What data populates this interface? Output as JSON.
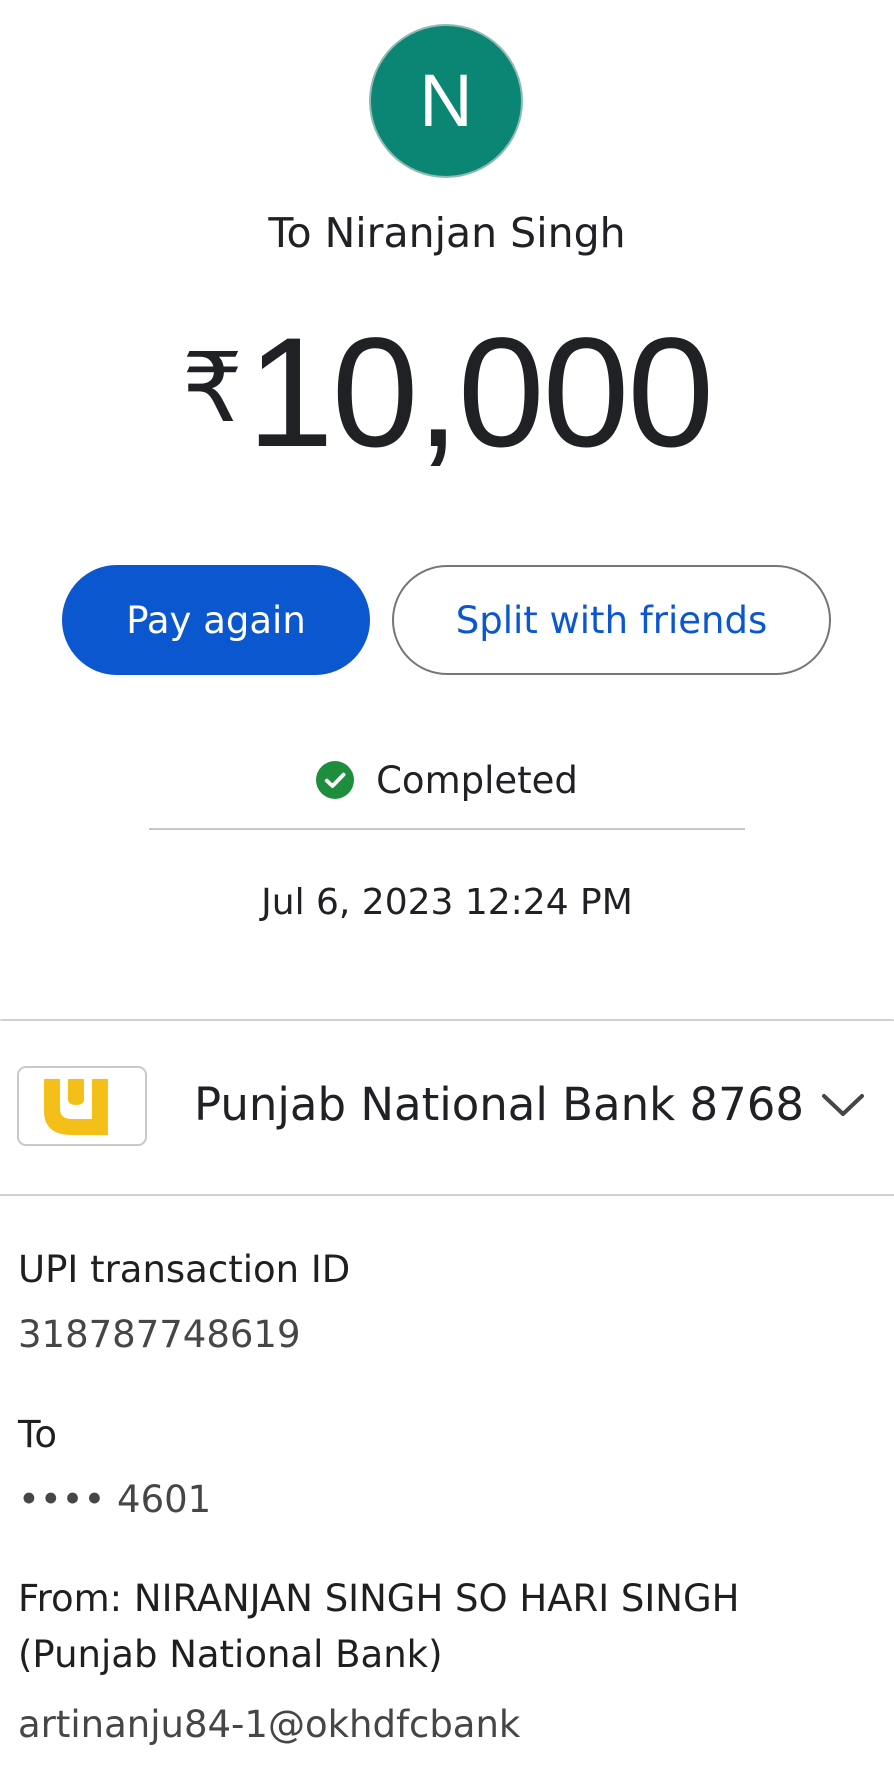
{
  "recipient": {
    "initial": "N",
    "avatar_color": "#0b8574",
    "title": "To Niranjan Singh"
  },
  "payment": {
    "currency_symbol": "₹",
    "amount": "10,000"
  },
  "actions": {
    "pay_again_label": "Pay again",
    "split_label": "Split with friends",
    "primary_color": "#0b57d0"
  },
  "status": {
    "icon": "check-circle-icon",
    "color": "#1e8e3e",
    "label": "Completed"
  },
  "datetime": "Jul 6, 2023 12:24 PM",
  "bank": {
    "logo": "pnb-logo",
    "name": "Punjab National Bank 8768",
    "expand_icon": "chevron-down-icon"
  },
  "details": {
    "txn_label": "UPI transaction ID",
    "txn_id": "318787748619",
    "to_label": "To",
    "to_account": "•••• 4601",
    "from_label": "From: NIRANJAN SINGH SO HARI SINGH (Punjab National Bank)",
    "from_upi": "artinanju84-1@okhdfcbank"
  }
}
